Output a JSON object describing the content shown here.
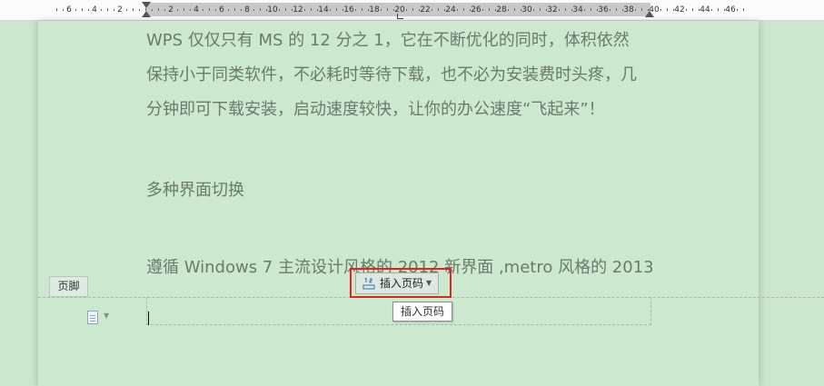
{
  "ruler": {
    "labels": [
      "6",
      "4",
      "2",
      "2",
      "4",
      "6",
      "8",
      "10",
      "12",
      "14",
      "16",
      "18",
      "20",
      "22",
      "24",
      "26",
      "28",
      "30",
      "32",
      "34",
      "36",
      "38",
      "40",
      "42",
      "44",
      "46"
    ]
  },
  "document": {
    "paragraphs": [
      "WPS 仅仅只有 MS 的 12 分之 1，它在不断优化的同时，体积依然",
      "保持小于同类软件，不必耗时等待下载，也不必为安装费时头疼，几",
      "分钟即可下载安装，启动速度较快，让你的办公速度“飞起来”！",
      "多种界面切换",
      "遵循 Windows 7 主流设计风格的 2012 新界面 ,metro 风格的 2013"
    ]
  },
  "footer": {
    "tab_label": "页脚",
    "insert_button_label": "插入页码",
    "tooltip_text": "插入页码"
  },
  "colors": {
    "background": "#cbe6cd",
    "highlight_frame": "#e02424",
    "body_text": "#6b7a6b"
  },
  "icons": {
    "footer_doc": "document-icon",
    "insert_button": "page-number-icon",
    "dropdown": "chevron-down-icon"
  }
}
